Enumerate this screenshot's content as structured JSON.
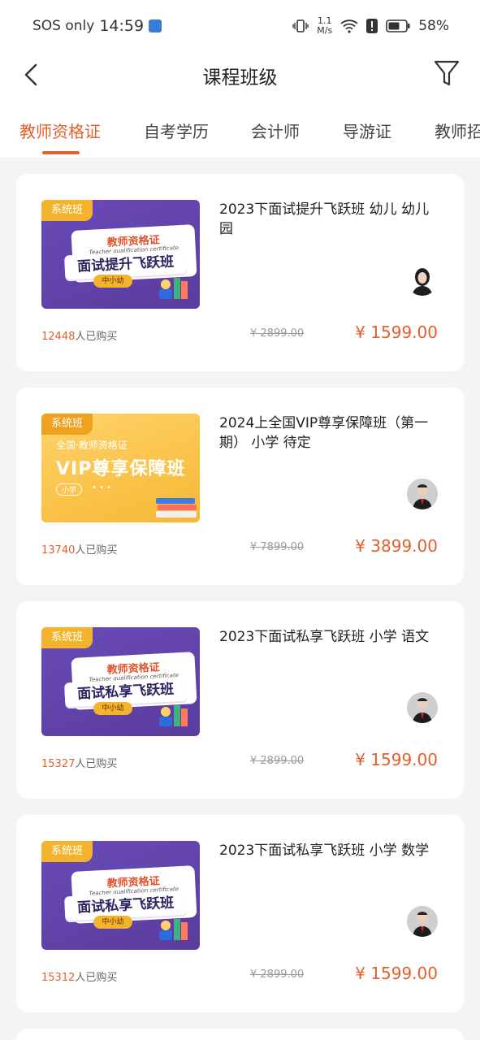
{
  "status_bar": {
    "carrier": "SOS only",
    "time": "14:59",
    "net_speed_value": "1.1",
    "net_speed_unit": "M/s",
    "battery": "58%"
  },
  "header": {
    "title": "课程班级",
    "back_icon": "chevron-left-icon",
    "filter_icon": "filter-icon"
  },
  "tabs": [
    "教师资格证",
    "自考学历",
    "会计师",
    "导游证",
    "教师招"
  ],
  "active_tab": 0,
  "courses": [
    {
      "tag": "系统班",
      "cover_top": "教师资格证",
      "cover_en": "Teacher qualification certificate",
      "cover_main": "面试提升飞跃班",
      "cover_sub": "中小幼",
      "title": "2023下面试提升飞跃班 幼儿 幼儿园",
      "buyers": "12448",
      "buyers_suffix": "人已购买",
      "original_price": "¥ 2899.00",
      "price": "¥ 1599.00"
    },
    {
      "tag": "系统班",
      "cover_top": "全国·教师资格证",
      "cover_main": "VIP尊享保障班",
      "cover_sub": "小学",
      "cover_dots": "• • •",
      "title": "2024上全国VIP尊享保障班（第一期） 小学 待定",
      "buyers": "13740",
      "buyers_suffix": "人已购买",
      "original_price": "¥ 7899.00",
      "price": "¥ 3899.00"
    },
    {
      "tag": "系统班",
      "cover_top": "教师资格证",
      "cover_en": "Teacher qualification certificate",
      "cover_main": "面试私享飞跃班",
      "cover_sub": "中小幼",
      "title": "2023下面试私享飞跃班 小学 语文",
      "buyers": "15327",
      "buyers_suffix": "人已购买",
      "original_price": "¥ 2899.00",
      "price": "¥ 1599.00"
    },
    {
      "tag": "系统班",
      "cover_top": "教师资格证",
      "cover_en": "Teacher qualification certificate",
      "cover_main": "面试私享飞跃班",
      "cover_sub": "中小幼",
      "title": "2023下面试私享飞跃班 小学 数学",
      "buyers": "15312",
      "buyers_suffix": "人已购买",
      "original_price": "¥ 2899.00",
      "price": "¥ 1599.00"
    }
  ],
  "colors": {
    "accent": "#e4602a",
    "cover_purple": "#5a3c9e",
    "cover_yellow": "#f7b733",
    "tag": "#f4b32c"
  }
}
